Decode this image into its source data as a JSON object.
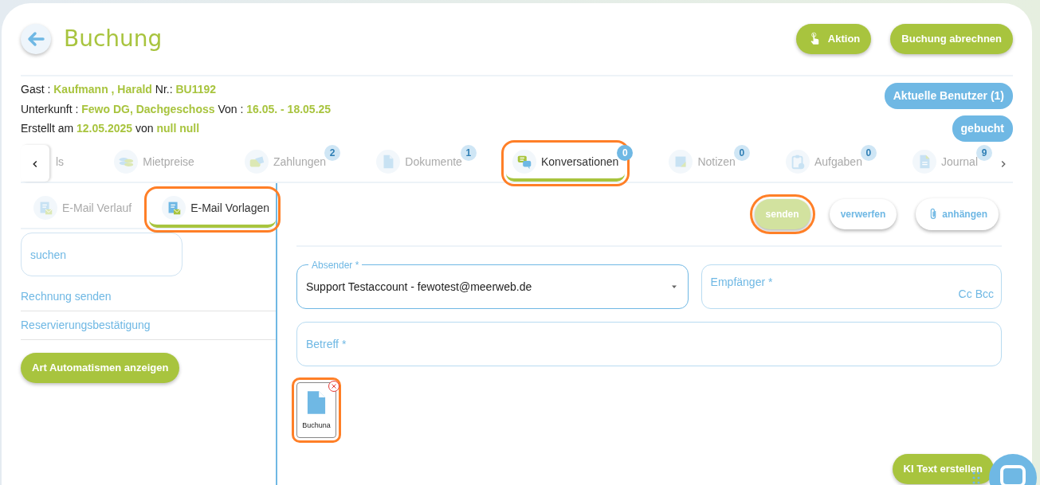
{
  "header": {
    "title": "Buchung",
    "buttons": [
      {
        "label": "Aktion",
        "kind": "icon"
      },
      {
        "label": "Buchung abrechnen",
        "kind": "plain"
      }
    ]
  },
  "info": [
    "Gast : **Kaufmann , Harald** Nr.: **BU1192**",
    "Unterkunft : **Fewo DG, Dachgeschoss** Von : **16.05. - 18.05.25**",
    "Erstellt am **12.05.2025** von **null null**"
  ],
  "badges": [
    "Aktuelle Benutzer (1)",
    "gebucht"
  ],
  "tabs": [
    {
      "label": "ls",
      "selected": false,
      "highlighted": false
    },
    {
      "label": "Mietpreise",
      "selected": false,
      "highlighted": false
    },
    {
      "label": "Zahlungen",
      "count": "2",
      "selected": false,
      "highlighted": false
    },
    {
      "label": "Dokumente",
      "count": "1",
      "selected": false,
      "highlighted": false
    },
    {
      "label": "Konversationen",
      "count": "0",
      "selected": true,
      "highlighted": true
    },
    {
      "label": "Notizen",
      "count": "0",
      "selected": false,
      "highlighted": false
    },
    {
      "label": "Aufgaben",
      "count": "0",
      "selected": false,
      "highlighted": false
    },
    {
      "label": "Journal",
      "count": "9",
      "selected": false,
      "highlighted": false
    }
  ],
  "subtabs": [
    {
      "label": "E-Mail Verlauf",
      "selected": false,
      "highlighted": false
    },
    {
      "label": "E-Mail Vorlagen",
      "selected": true,
      "highlighted": true
    }
  ],
  "search": {
    "placeholder": "suchen"
  },
  "templates": [
    "Rechnung senden",
    "Reservierungsbestätigung"
  ],
  "automation_button": "Art Automatismen anzeigen",
  "actions": [
    {
      "label": "senden",
      "kind": "primary",
      "disabled": true,
      "highlighted": true
    },
    {
      "label": "verwerfen",
      "kind": "plain",
      "disabled": false,
      "highlighted": false
    },
    {
      "label": "anhängen",
      "kind": "attach",
      "disabled": false,
      "highlighted": false
    }
  ],
  "form": {
    "sender_label": "Absender *",
    "sender_value": "Support Testaccount - fewotest@meerweb.de",
    "recipient_placeholder": "Empfänger *",
    "cc": "Cc",
    "bcc": "Bcc",
    "subject_placeholder": "Betreff *"
  },
  "attachments": [
    {
      "name": "Buchuna",
      "highlighted": true
    }
  ],
  "ai_button": "KI Text erstellen"
}
